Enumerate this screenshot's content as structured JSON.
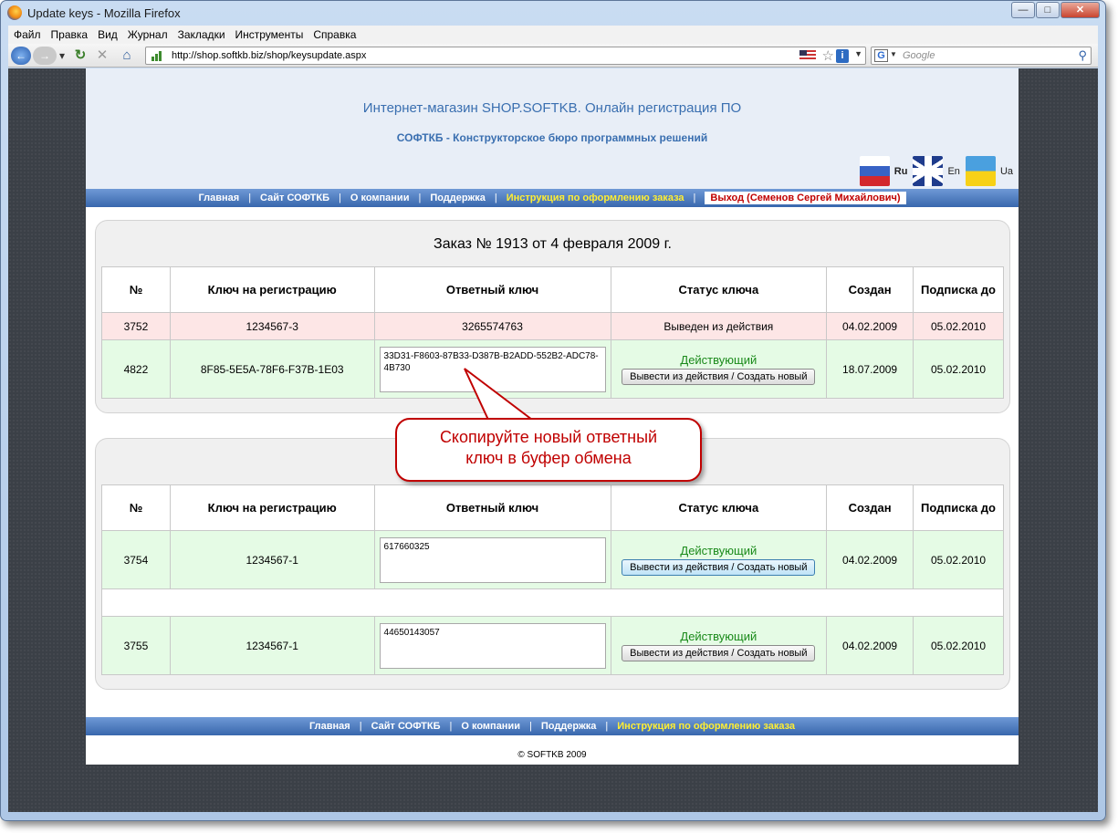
{
  "window": {
    "title": "Update keys - Mozilla Firefox"
  },
  "menu": [
    "Файл",
    "Правка",
    "Вид",
    "Журнал",
    "Закладки",
    "Инструменты",
    "Справка"
  ],
  "url": "http://shop.softkb.biz/shop/keysupdate.aspx",
  "search_placeholder": "Google",
  "header": {
    "title": "Интернет-магазин SHOP.SOFTKB. Онлайн регистрация ПО",
    "subtitle": "СОФТКБ - Конструкторское бюро программных решений",
    "langs": [
      "Ru",
      "En",
      "Ua"
    ]
  },
  "nav_top": {
    "items": [
      "Главная",
      "Сайт СОФТКБ",
      "О компании",
      "Поддержка",
      "Инструкция по оформлению заказа"
    ],
    "separator": "|",
    "logout": "Выход (Семенов Сергей Михайлович)"
  },
  "order1": {
    "title": "Заказ № 1913 от 4 февраля 2009 г.",
    "headers": [
      "№",
      "Ключ на регистрацию",
      "Ответный ключ",
      "Статус ключа",
      "Создан",
      "Подписка до"
    ],
    "rows": [
      {
        "num": "3752",
        "reg_key": "1234567-3",
        "resp_key": "3265574763",
        "status": "Выведен из действия",
        "created": "04.02.2009",
        "until": "05.02.2010"
      },
      {
        "num": "4822",
        "reg_key": "8F85-5E5A-78F6-F37B-1E03",
        "resp_key": "33D31-F8603-87B33-D387B-B2ADD-552B2-ADC78-4B730",
        "status": "Действующий",
        "action": "Вывести из действия / Создать новый",
        "created": "18.07.2009",
        "until": "05.02.2010"
      }
    ]
  },
  "order2": {
    "headers": [
      "№",
      "Ключ на регистрацию",
      "Ответный ключ",
      "Статус ключа",
      "Создан",
      "Подписка до"
    ],
    "rows": [
      {
        "num": "3754",
        "reg_key": "1234567-1",
        "resp_key": "617660325",
        "status": "Действующий",
        "action": "Вывести из действия / Создать новый",
        "created": "04.02.2009",
        "until": "05.02.2010"
      },
      {
        "num": "3755",
        "reg_key": "1234567-1",
        "resp_key": "44650143057",
        "status": "Действующий",
        "action": "Вывести из действия / Создать новый",
        "created": "04.02.2009",
        "until": "05.02.2010"
      }
    ]
  },
  "callout": {
    "line1": "Скопируйте новый ответный",
    "line2": "ключ в буфер обмена"
  },
  "nav_bottom": {
    "items": [
      "Главная",
      "Сайт СОФТКБ",
      "О компании",
      "Поддержка",
      "Инструкция по оформлению заказа"
    ],
    "separator": "|"
  },
  "footer": "© SOFTKB 2009",
  "colors": {
    "accent": "#3a6fb0",
    "red": "#c00000",
    "green": "#1a8a1a",
    "highlight": "#ffee33"
  }
}
